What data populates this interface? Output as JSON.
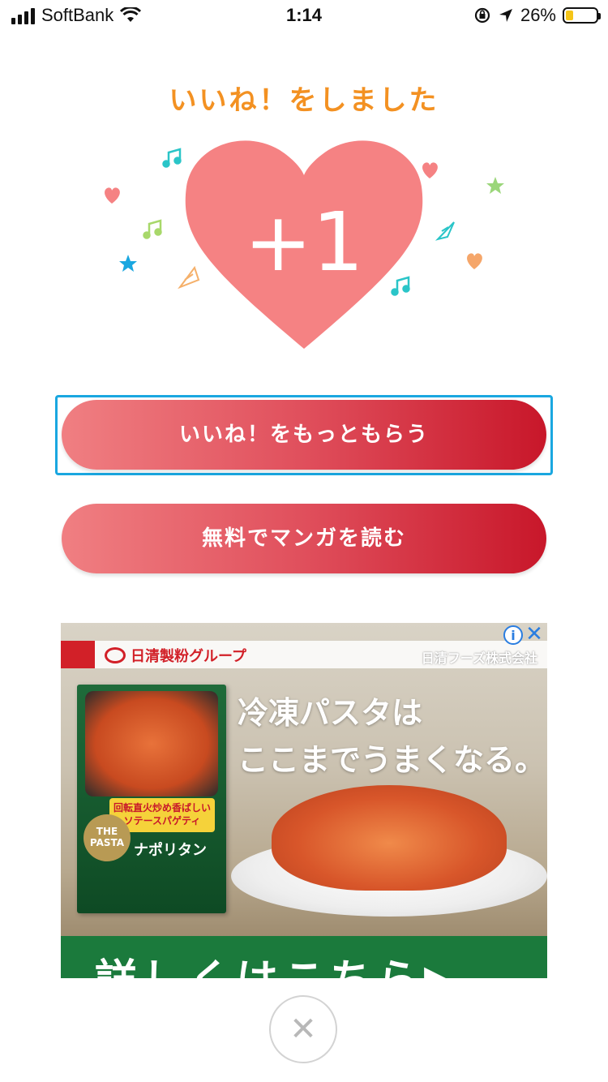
{
  "status_bar": {
    "carrier": "SoftBank",
    "time": "1:14",
    "battery_percent": "26%",
    "battery_level": 0.26,
    "icons": [
      "signal-icon",
      "wifi-icon",
      "rotation-lock-icon",
      "location-arrow-icon",
      "battery-icon"
    ]
  },
  "title": "いいね！をしました",
  "heart": {
    "label": "+1",
    "color": "#f58283"
  },
  "buttons": {
    "get_more_likes": "いいね！をもっともらう",
    "read_free_manga": "無料でマンガを読む"
  },
  "ad": {
    "brand": "日清製粉グループ",
    "company": "日清フーズ株式会社",
    "headline_line1": "冷凍パスタは",
    "headline_line2": "ここまでうまくなる。",
    "package_badge_line1": "回転直火炒め香ばしい",
    "package_badge_line2": "ソテースパゲティ",
    "package_circle_line1": "THE",
    "package_circle_line2": "PASTA",
    "package_name": "ナポリタン",
    "cta": "詳しくはこちら▶"
  },
  "colors": {
    "title_orange": "#f39122",
    "button_gradient_start": "#f07f82",
    "button_gradient_end": "#c8172a",
    "focus_ring": "#1aa7e0"
  }
}
